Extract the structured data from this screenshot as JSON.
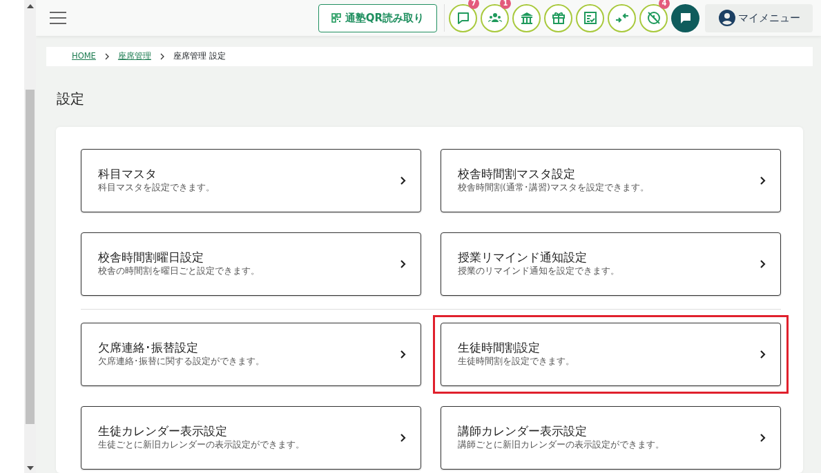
{
  "header": {
    "qr_button": "通塾QR読み取り",
    "icon_buttons": [
      {
        "kind": "chat",
        "badge": "7"
      },
      {
        "kind": "people",
        "badge": "1"
      },
      {
        "kind": "school"
      },
      {
        "kind": "gift"
      },
      {
        "kind": "checklist"
      },
      {
        "kind": "compress"
      },
      {
        "kind": "clock-off",
        "badge": "4"
      }
    ],
    "messages_button": {
      "kind": "message"
    },
    "my_menu": "マイメニュー"
  },
  "breadcrumb": [
    {
      "label": "HOME",
      "link": true
    },
    {
      "label": "座席管理",
      "link": true
    },
    {
      "label": "座席管理 設定",
      "link": false
    }
  ],
  "page_title": "設定",
  "sections": [
    {
      "items": [
        {
          "title": "科目マスタ",
          "description": "科目マスタを設定できます。",
          "highlighted": false
        },
        {
          "title": "校舎時間割マスタ設定",
          "description": "校舎時間割(通常･講習)マスタを設定できます。",
          "highlighted": false
        },
        {
          "title": "校舎時間割曜日設定",
          "description": "校舎の時間割を曜日ごと設定できます。",
          "highlighted": false
        },
        {
          "title": "授業リマインド通知設定",
          "description": "授業のリマインド通知を設定できます。",
          "highlighted": false
        }
      ]
    },
    {
      "items": [
        {
          "title": "欠席連絡･振替設定",
          "description": "欠席連絡･振替に関する設定ができます。",
          "highlighted": false
        },
        {
          "title": "生徒時間割設定",
          "description": "生徒時間割を設定できます。",
          "highlighted": true
        },
        {
          "title": "生徒カレンダー表示設定",
          "description": "生徒ごとに新旧カレンダーの表示設定ができます。",
          "highlighted": false
        },
        {
          "title": "講師カレンダー表示設定",
          "description": "講師ごとに新旧カレンダーの表示設定ができます。",
          "highlighted": false
        }
      ]
    }
  ]
}
